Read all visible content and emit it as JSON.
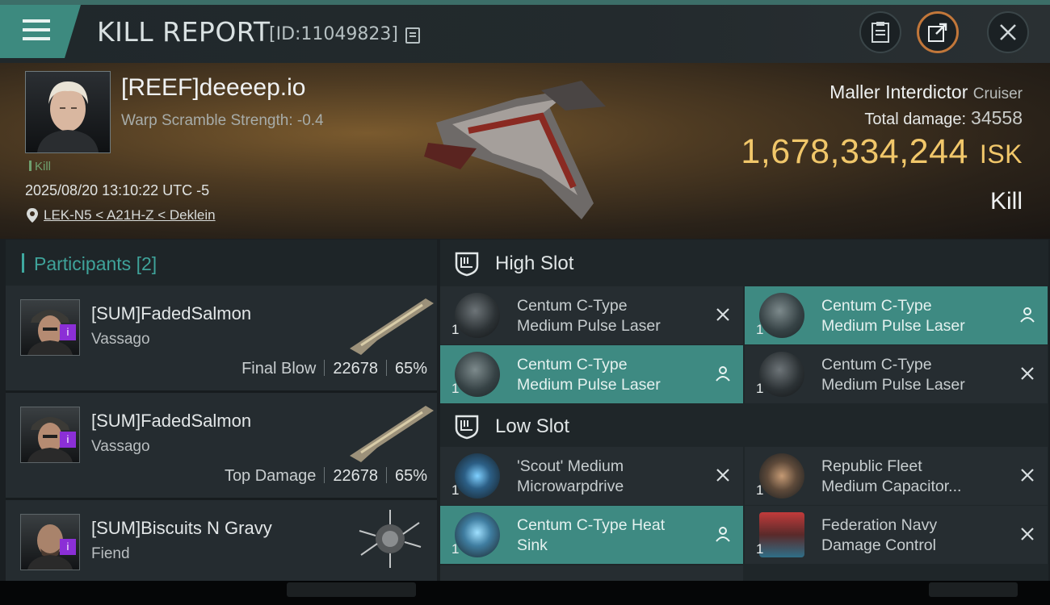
{
  "header": {
    "title": "KILL REPORT",
    "report_id": "[ID:11049823]"
  },
  "victim": {
    "name": "[REEF]deeeep.io",
    "warp_scramble": "Warp Scramble Strength: -0.4",
    "kill_tag": "Kill",
    "datetime": "2025/08/20 13:10:22 UTC -5",
    "location": "LEK-N5 < A21H-Z < Deklein",
    "ship_name": "Maller Interdictor",
    "ship_class": "Cruiser",
    "total_damage_label": "Total damage:",
    "total_damage": "34558",
    "isk_value": "1,678,334,244",
    "isk_unit": "ISK",
    "result": "Kill"
  },
  "participants": {
    "label": "Participants",
    "count": "[2]",
    "rows": [
      {
        "name": "[SUM]FadedSalmon",
        "ship": "Vassago",
        "stat_label": "Final Blow",
        "damage": "22678",
        "percent": "65%",
        "badge": "i"
      },
      {
        "name": "[SUM]FadedSalmon",
        "ship": "Vassago",
        "stat_label": "Top Damage",
        "damage": "22678",
        "percent": "65%",
        "badge": "i"
      },
      {
        "name": "[SUM]Biscuits N Gravy",
        "ship": "Fiend",
        "badge": "i"
      }
    ]
  },
  "slots": {
    "high": {
      "label": "High Slot",
      "items": [
        {
          "qty": "1",
          "name_line1": "Centum C-Type",
          "name_line2": "Medium Pulse Laser",
          "status": "destroyed",
          "highlight": false
        },
        {
          "qty": "1",
          "name_line1": "Centum C-Type",
          "name_line2": "Medium Pulse Laser",
          "status": "dropped",
          "highlight": true
        },
        {
          "qty": "1",
          "name_line1": "Centum C-Type",
          "name_line2": "Medium Pulse Laser",
          "status": "dropped",
          "highlight": true
        },
        {
          "qty": "1",
          "name_line1": "Centum C-Type",
          "name_line2": "Medium Pulse Laser",
          "status": "destroyed",
          "highlight": false
        }
      ]
    },
    "low": {
      "label": "Low Slot",
      "items": [
        {
          "qty": "1",
          "name_line1": "'Scout' Medium",
          "name_line2": "Microwarpdrive",
          "status": "destroyed",
          "highlight": false
        },
        {
          "qty": "1",
          "name_line1": "Republic Fleet",
          "name_line2": "Medium Capacitor...",
          "status": "destroyed",
          "highlight": false
        },
        {
          "qty": "1",
          "name_line1": "Centum C-Type Heat",
          "name_line2": "Sink",
          "status": "dropped",
          "highlight": true
        },
        {
          "qty": "1",
          "name_line1": "Federation Navy",
          "name_line2": "Damage Control",
          "status": "destroyed",
          "highlight": false
        }
      ]
    }
  },
  "colors": {
    "accent": "#3e8a82",
    "isk": "#f1c76a",
    "badge": "#8b2fd6"
  }
}
